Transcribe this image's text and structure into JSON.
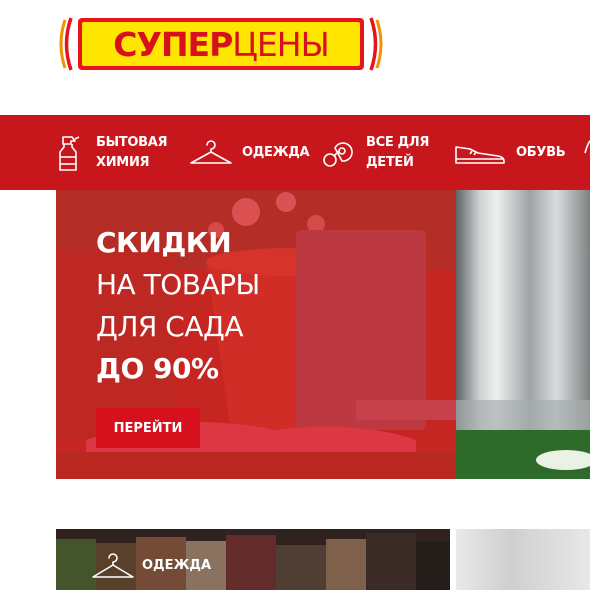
{
  "logo": {
    "part1": "СУПЕР",
    "part2": "ЦЕНЫ"
  },
  "nav": {
    "items": [
      {
        "line1": "БЫТОВАЯ",
        "line2": "ХИМИЯ",
        "icon": "spray-bottle-icon"
      },
      {
        "line1": "ОДЕЖДА",
        "line2": "",
        "icon": "hanger-icon"
      },
      {
        "line1": "ВСЕ ДЛЯ",
        "line2": "ДЕТЕЙ",
        "icon": "pacifier-icon"
      },
      {
        "line1": "ОБУВЬ",
        "line2": "",
        "icon": "sneaker-icon"
      }
    ]
  },
  "hero": {
    "line1": "СКИДКИ",
    "line2": "НА ТОВАРЫ",
    "line3": "ДЛЯ САДА",
    "line4": "ДО 90%",
    "button_label": "ПЕРЕЙТИ"
  },
  "tiles": {
    "clothes_label": "ОДЕЖДА"
  },
  "colors": {
    "brand_red": "#c8161d",
    "logo_yellow": "#ffe600",
    "logo_orange": "#f39200"
  }
}
